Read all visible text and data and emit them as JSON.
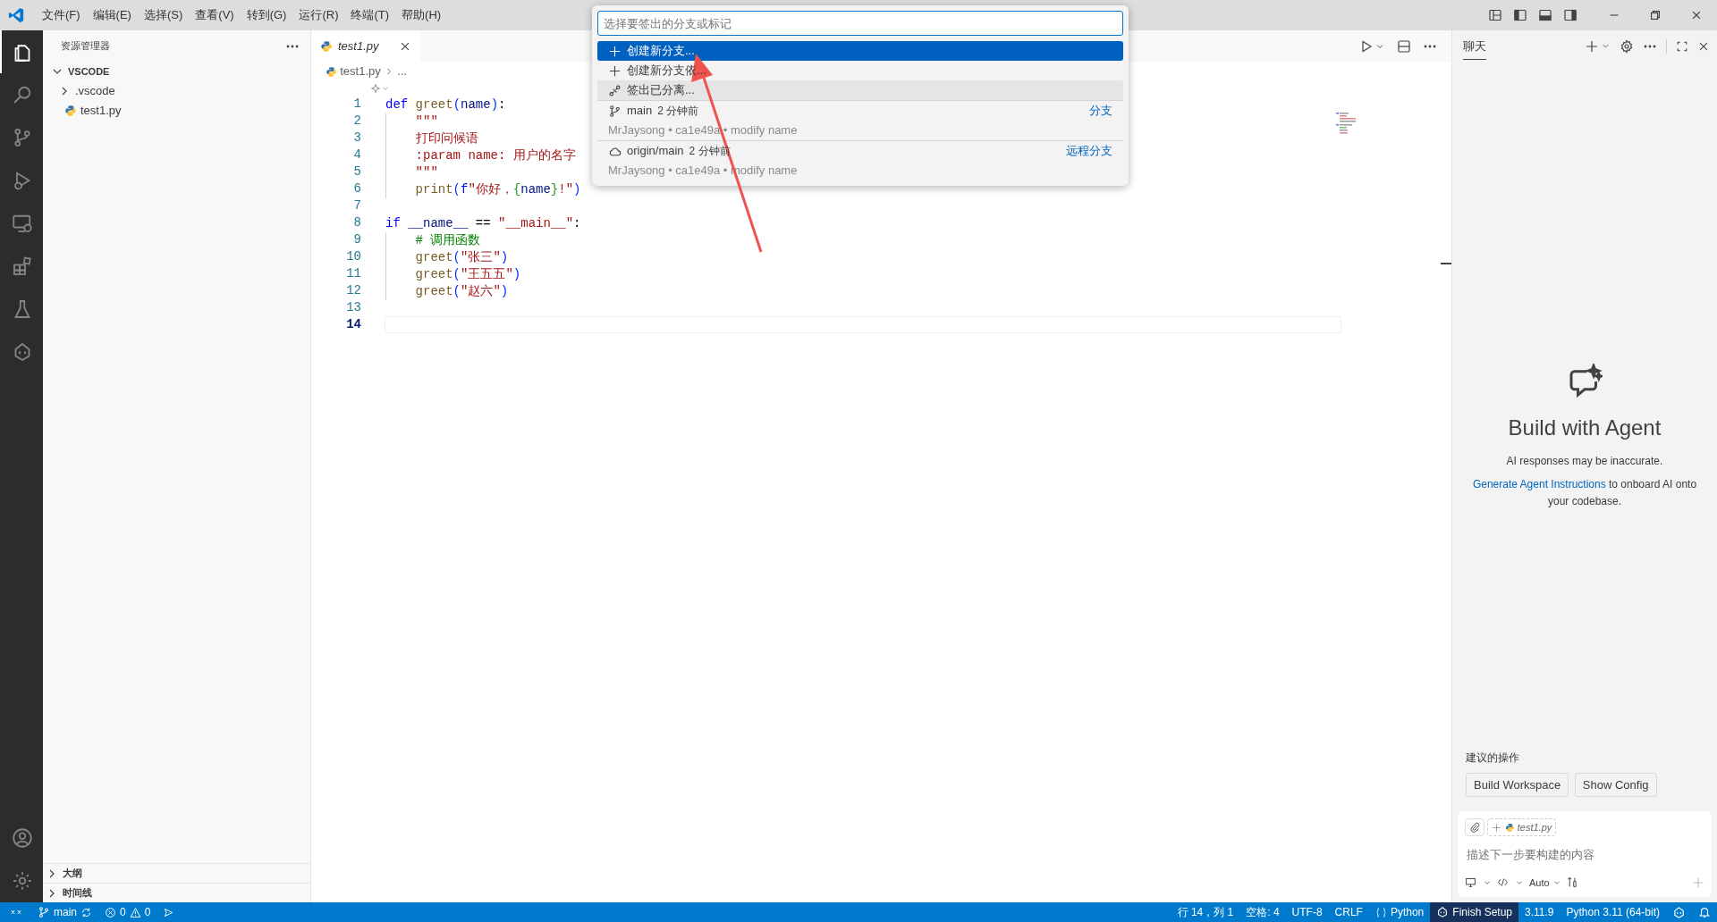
{
  "menu": [
    "文件(F)",
    "编辑(E)",
    "选择(S)",
    "查看(V)",
    "转到(G)",
    "运行(R)",
    "终端(T)",
    "帮助(H)"
  ],
  "activity_bar": [
    {
      "selected": true
    },
    {
      "selected": false
    },
    {
      "selected": false
    },
    {
      "selected": false
    },
    {
      "selected": false
    },
    {
      "selected": false
    },
    {
      "selected": false
    },
    {
      "selected": false
    }
  ],
  "sidebar": {
    "title": "资源管理器",
    "tree": [
      {
        "kind": "folder",
        "label": "VSCODE",
        "expanded": true,
        "children": [
          {
            "kind": "folder",
            "label": ".vscode",
            "expanded": false
          },
          {
            "kind": "file",
            "label": "test1.py"
          }
        ]
      }
    ],
    "sections": [
      {
        "label": "大纲",
        "expanded": false
      },
      {
        "label": "时间线",
        "expanded": false
      }
    ]
  },
  "editor": {
    "tabs": [
      {
        "label": "test1.py",
        "selected": true
      }
    ],
    "breadcrumb": [
      "test1.py",
      "..."
    ],
    "lines": [
      {
        "number": "1",
        "current": false,
        "indent": false,
        "tokens": [
          {
            "kind": "kw",
            "text": "def "
          },
          {
            "kind": "fn",
            "text": "greet"
          },
          {
            "kind": "br",
            "text": "("
          },
          {
            "kind": "var",
            "text": "name"
          },
          {
            "kind": "br",
            "text": ")"
          },
          {
            "kind": "plain",
            "text": ":"
          }
        ]
      },
      {
        "number": "2",
        "current": false,
        "indent": true,
        "tokens": [
          {
            "kind": "str",
            "text": "\"\"\""
          }
        ]
      },
      {
        "number": "3",
        "current": false,
        "indent": true,
        "tokens": [
          {
            "kind": "str",
            "text": "打印问候语"
          }
        ]
      },
      {
        "number": "4",
        "current": false,
        "indent": true,
        "tokens": [
          {
            "kind": "str",
            "text": ":param name: 用户的名字"
          }
        ]
      },
      {
        "number": "5",
        "current": false,
        "indent": true,
        "tokens": [
          {
            "kind": "str",
            "text": "\"\"\""
          }
        ]
      },
      {
        "number": "6",
        "current": false,
        "indent": true,
        "tokens": [
          {
            "kind": "fn",
            "text": "print"
          },
          {
            "kind": "br",
            "text": "("
          },
          {
            "kind": "kw",
            "text": "f"
          },
          {
            "kind": "str",
            "text": "\"你好，"
          },
          {
            "kind": "br2",
            "text": "{"
          },
          {
            "kind": "var",
            "text": "name"
          },
          {
            "kind": "br2",
            "text": "}"
          },
          {
            "kind": "str",
            "text": "!\""
          },
          {
            "kind": "br",
            "text": ")"
          }
        ]
      },
      {
        "number": "7",
        "current": false,
        "indent": false
      },
      {
        "number": "8",
        "current": false,
        "indent": false,
        "tokens": [
          {
            "kind": "kw",
            "text": "if "
          },
          {
            "kind": "var",
            "text": "__name__"
          },
          {
            "kind": "plain",
            "text": " == "
          },
          {
            "kind": "str",
            "text": "\"__main__\""
          },
          {
            "kind": "plain",
            "text": ":"
          }
        ]
      },
      {
        "number": "9",
        "current": false,
        "indent": true,
        "tokens": [
          {
            "kind": "comment",
            "text": "# 调用函数"
          }
        ]
      },
      {
        "number": "10",
        "current": false,
        "indent": true,
        "tokens": [
          {
            "kind": "fn",
            "text": "greet"
          },
          {
            "kind": "br",
            "text": "("
          },
          {
            "kind": "str",
            "text": "\"张三\""
          },
          {
            "kind": "br",
            "text": ")"
          }
        ]
      },
      {
        "number": "11",
        "current": false,
        "indent": true,
        "tokens": [
          {
            "kind": "fn",
            "text": "greet"
          },
          {
            "kind": "br",
            "text": "("
          },
          {
            "kind": "str",
            "text": "\"王五五\""
          },
          {
            "kind": "br",
            "text": ")"
          }
        ]
      },
      {
        "number": "12",
        "current": false,
        "indent": true,
        "tokens": [
          {
            "kind": "fn",
            "text": "greet"
          },
          {
            "kind": "br",
            "text": "("
          },
          {
            "kind": "str",
            "text": "\"赵六\""
          },
          {
            "kind": "br",
            "text": ")"
          }
        ]
      },
      {
        "number": "13",
        "current": false,
        "indent": false
      },
      {
        "number": "14",
        "current": true,
        "indent": false
      }
    ]
  },
  "quick_pick": {
    "placeholder": "选择要签出的分支或标记",
    "items": [
      {
        "kind": "create",
        "label": "创建新分支...",
        "selected": true,
        "hovered": false
      },
      {
        "kind": "create",
        "label": "创建新分支依...",
        "selected": false,
        "hovered": false
      },
      {
        "kind": "detach",
        "label": "签出已分离...",
        "selected": false,
        "hovered": true
      },
      {
        "kind": "branch",
        "label": "main",
        "time": "2 分钟前",
        "detail": "MrJaysong • ca1e49a • modify name",
        "tag": "分支",
        "selected": false,
        "hovered": false
      },
      {
        "kind": "remote",
        "label": "origin/main",
        "time": "2 分钟前",
        "detail": "MrJaysong • ca1e49a • modify name",
        "tag": "远程分支",
        "selected": false,
        "hovered": false
      }
    ]
  },
  "chat": {
    "tabs": [
      {
        "label": "聊天",
        "selected": true
      }
    ],
    "title": "Build with Agent",
    "disclaimer": "AI responses may be inaccurate.",
    "onboard": {
      "link": "Generate Agent Instructions",
      "text": " to onboard AI onto your codebase."
    },
    "suggestions_title": "建议的操作",
    "suggestions": [
      "Build Workspace",
      "Show Config"
    ],
    "context_file": "test1.py",
    "placeholder": "描述下一步要构建的内容",
    "mode": "Auto"
  },
  "status_bar": {
    "branch": "main",
    "errors": "0",
    "warnings": "0",
    "right": [
      {
        "kind": "text",
        "text": "行 14，列 1"
      },
      {
        "kind": "text",
        "text": "空格: 4"
      },
      {
        "kind": "text",
        "text": "UTF-8"
      },
      {
        "kind": "text",
        "text": "CRLF"
      },
      {
        "kind": "language",
        "text": "Python"
      },
      {
        "kind": "setup",
        "text": "Finish Setup"
      },
      {
        "kind": "text",
        "text": "3.11.9"
      },
      {
        "kind": "text",
        "text": "Python 3.11 (64-bit)"
      }
    ]
  }
}
